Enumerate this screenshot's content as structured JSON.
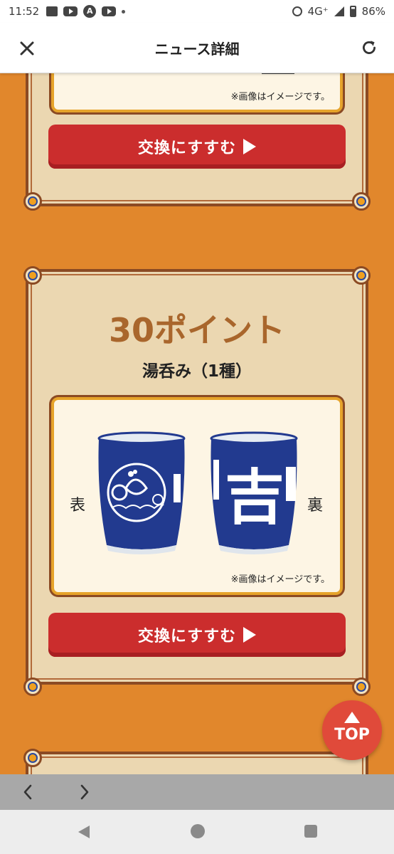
{
  "status_bar": {
    "time": "11:52",
    "network": "4G⁺",
    "battery": "86%"
  },
  "header": {
    "title": "ニュース詳細"
  },
  "sections": [
    {
      "caption": "※画像はイメージです。",
      "button_label": "交換にすすむ"
    },
    {
      "points": "30ポイント",
      "item": "湯呑み（1種）",
      "front_label": "表",
      "back_label": "裏",
      "cup_kanji": "吉",
      "caption": "※画像はイメージです。",
      "button_label": "交換にすすむ"
    }
  ],
  "top_button": {
    "label": "TOP"
  },
  "colors": {
    "background": "#e1872c",
    "panel": "#ebd7b1",
    "button": "#cb2d2d",
    "points_text": "#a9662c",
    "cup_blue": "#223a8f"
  }
}
